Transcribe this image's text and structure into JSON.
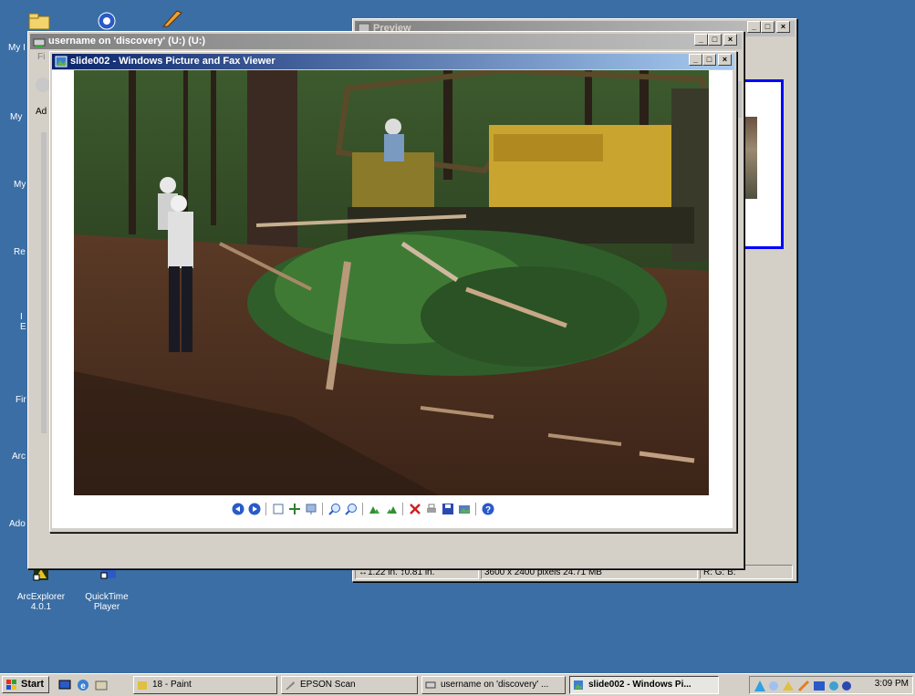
{
  "desktop": {
    "left_labels": [
      "My I",
      "My",
      "My",
      "Re",
      "I\nE",
      "Fir",
      "Arc",
      "Ado"
    ],
    "icons": [
      {
        "name": "arcexplorer",
        "label": "ArcExplorer\n4.0.1"
      },
      {
        "name": "quicktime",
        "label": "QuickTime\nPlayer"
      }
    ]
  },
  "preview_window": {
    "title": "Preview",
    "status": {
      "size_in": "↔1.22 in. ↕0.81 in.",
      "pixels": "3600 x 2400 pixels 24.71 MB",
      "rgb": "R: G: B:"
    }
  },
  "explorer_window": {
    "title": "username on 'discovery' (U:) (U:)",
    "menu_fragment": "Fi",
    "address_fragment": "Ad"
  },
  "viewer_window": {
    "title": "slide002 - Windows Picture and Fax Viewer",
    "photo_alt": "Bulldozer clearing brush in a forest with workers in hard hats",
    "toolbar": [
      "previous-image",
      "next-image",
      "best-fit",
      "actual-size",
      "slideshow",
      "zoom-in",
      "zoom-out",
      "rotate-clockwise",
      "rotate-counterclockwise",
      "delete",
      "print",
      "save",
      "open-for-editing",
      "help"
    ]
  },
  "taskbar": {
    "start_label": "Start",
    "tasks": [
      {
        "label": "18 - Paint",
        "active": false
      },
      {
        "label": "EPSON Scan",
        "active": false
      },
      {
        "label": "username on 'discovery' ...",
        "active": false
      },
      {
        "label": "slide002 - Windows Pi...",
        "active": true
      }
    ],
    "clock": "3:09 PM"
  },
  "window_controls": {
    "minimize": "_",
    "maximize": "□",
    "close": "×"
  }
}
